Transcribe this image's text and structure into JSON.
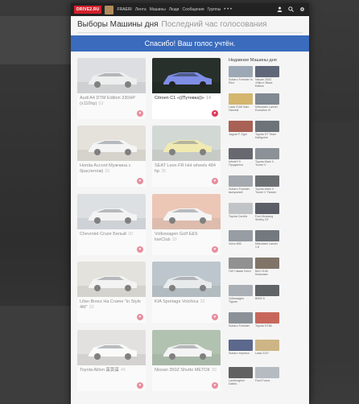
{
  "topbar": {
    "logo": "DRIVE2.RU",
    "username": "FRAERI",
    "nav": [
      "Лента",
      "Машины",
      "Люди",
      "Сообщения",
      "Группы"
    ],
    "more": "• • •"
  },
  "header": {
    "title": "Выборы Машины дня",
    "subtitle": "Последний час голосования"
  },
  "banner": "Спасибо! Ваш голос учтён.",
  "cards": [
    {
      "caption": "Audi A4 DTM Edition 330HP",
      "count": "(x110hp)",
      "votes": "53",
      "bg": "#c9ccd1",
      "car": "#e9e9ea",
      "active": false
    },
    {
      "caption": "Citroen C1 «((Путевка))»",
      "count": "",
      "votes": "14",
      "bg": "#27302a",
      "car": "#7f8ee6",
      "active": true
    },
    {
      "caption": "Honda Accord Мужчина с браслетом)",
      "count": "",
      "votes": "20",
      "bg": "#d9d2c6",
      "car": "#f4f4f4",
      "active": false
    },
    {
      "caption": "SEAT Leon FR Hot wheels 484 hp",
      "count": "",
      "votes": "35",
      "bg": "#b7c2b8",
      "car": "#ece27a",
      "active": false
    },
    {
      "caption": "Chevrolet Cruze Белый",
      "count": "",
      "votes": "30",
      "bg": "#c9cfd6",
      "car": "#f3f3f3",
      "active": false
    },
    {
      "caption": "Volkswagen Golf E&S lowClub",
      "count": "",
      "votes": "30",
      "bg": "#e7a283",
      "car": "#f6f6f6",
      "active": false
    },
    {
      "caption": "Lifan Breez Ha Crame \"in Style 4M\"",
      "count": "",
      "votes": "20",
      "bg": "#d7d3c9",
      "car": "#f2f2f2",
      "active": false
    },
    {
      "caption": "KIA Sportage Volchica",
      "count": "",
      "votes": "32",
      "bg": "#8fa1ab",
      "car": "#dfe3e6",
      "active": false
    },
    {
      "caption": "Toyota Allion 蛋黄蛋",
      "count": "",
      "votes": "45",
      "bg": "#d4d1ce",
      "car": "#ffffff",
      "active": false
    },
    {
      "caption": "Nissan 350Z Shutto МЕТОК",
      "count": "",
      "votes": "30",
      "bg": "#7a9a7a",
      "car": "#f4f4f4",
      "active": false
    }
  ],
  "sidebar": {
    "title": "Недавние Машины дня",
    "items": [
      {
        "label": "Subaru Forester Is Red",
        "color": "#7f8fa0"
      },
      {
        "label": "Nissan 200Z «Nitro» Black Edition",
        "color": "#2f3850"
      },
      {
        "label": "Lada 2108 Sam Harvest",
        "color": "#c8a040"
      },
      {
        "label": "Mitsubishi Lancer Evolution IX",
        "color": "#5a6470"
      },
      {
        "label": "Jaguar F-Type",
        "color": "#903020"
      },
      {
        "label": "Toyota GT Team Kalligome",
        "color": "#404850"
      },
      {
        "label": "Infiniti FX Продается",
        "color": "#3a3a44"
      },
      {
        "label": "Toyota Mark II Tourer V",
        "color": "#6a7078"
      },
      {
        "label": "Subaru Forester выпускной",
        "color": "#8a9098"
      },
      {
        "label": "Toyota Mark II Tourer V Тюнинг",
        "color": "#404448"
      },
      {
        "label": "Toyota Corolla",
        "color": "#b0b4b8"
      },
      {
        "label": "Ford Mustang Shelby GT",
        "color": "#2a2e38"
      },
      {
        "label": "Volvo 850",
        "color": "#788088"
      },
      {
        "label": "Mitsubishi Lancer 1.6",
        "color": "#4a5058"
      },
      {
        "label": "ГАЗ Гамма Volvo",
        "color": "#707070"
      },
      {
        "label": "ВАЗ 2106 Классика",
        "color": "#5a4a3a"
      },
      {
        "label": "Volkswagen Tiguan",
        "color": "#9098a0"
      },
      {
        "label": "BMW 5",
        "color": "#303438"
      },
      {
        "label": "Subaru Forester",
        "color": "#687078"
      },
      {
        "label": "Toyota GT86",
        "color": "#b83828"
      },
      {
        "label": "Subaru Impreza",
        "color": "#2a3a6a"
      },
      {
        "label": "Lada 2107",
        "color": "#c0a060"
      },
      {
        "label": "Lamborghini Diablo",
        "color": "#303030"
      },
      {
        "label": "Ford Focus",
        "color": "#a0a8b0"
      }
    ]
  }
}
